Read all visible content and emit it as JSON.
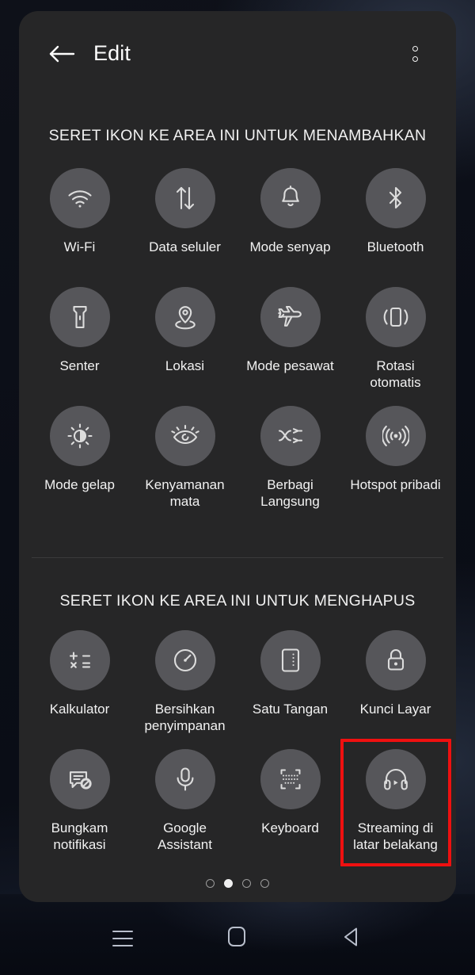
{
  "header": {
    "title": "Edit",
    "back_icon": "arrow-left-icon",
    "overflow_icon": "more-vertical-icon"
  },
  "sections": [
    {
      "id": "add",
      "heading": "SERET IKON KE AREA INI UNTUK MENAMBAHKAN",
      "tiles": [
        {
          "label": "Wi-Fi",
          "icon": "wifi-icon"
        },
        {
          "label": "Data seluler",
          "icon": "mobile-data-icon"
        },
        {
          "label": "Mode senyap",
          "icon": "bell-mute-icon"
        },
        {
          "label": "Bluetooth",
          "icon": "bluetooth-icon"
        },
        {
          "label": "Senter",
          "icon": "flashlight-icon"
        },
        {
          "label": "Lokasi",
          "icon": "location-pin-icon"
        },
        {
          "label": "Mode pesawat",
          "icon": "airplane-icon"
        },
        {
          "label": "Rotasi\notomatis",
          "icon": "auto-rotate-icon"
        },
        {
          "label": "Mode gelap",
          "icon": "dark-mode-icon"
        },
        {
          "label": "Kenyamanan\nmata",
          "icon": "eye-comfort-icon"
        },
        {
          "label": "Berbagi\nLangsung",
          "icon": "direct-share-icon"
        },
        {
          "label": "Hotspot pribadi",
          "icon": "hotspot-icon"
        }
      ]
    },
    {
      "id": "remove",
      "heading": "SERET IKON KE AREA INI UNTUK MENGHAPUS",
      "tiles": [
        {
          "label": "Kalkulator",
          "icon": "calculator-icon"
        },
        {
          "label": "Bersihkan\npenyimpanan",
          "icon": "storage-cleanup-icon"
        },
        {
          "label": "Satu Tangan",
          "icon": "one-hand-mode-icon"
        },
        {
          "label": "Kunci Layar",
          "icon": "lock-icon"
        },
        {
          "label": "Bungkam\nnotifikasi",
          "icon": "mute-notification-icon"
        },
        {
          "label": "Google\nAssistant",
          "icon": "microphone-icon"
        },
        {
          "label": "Keyboard",
          "icon": "keyboard-icon"
        },
        {
          "label": "Streaming di\nlatar belakang",
          "icon": "headphones-play-icon",
          "highlighted": true
        }
      ]
    }
  ],
  "pager": {
    "total": 4,
    "active_index": 1
  },
  "navbar": {
    "recents_label": "recents-icon",
    "home_label": "home-icon",
    "back_label": "back-icon"
  },
  "colors": {
    "panel_background": "#262627",
    "tile_circle": "#56565a",
    "text_primary": "#f2f2f2",
    "highlight_box": "#ef1010",
    "navbar_icon": "#b9bfcc"
  }
}
